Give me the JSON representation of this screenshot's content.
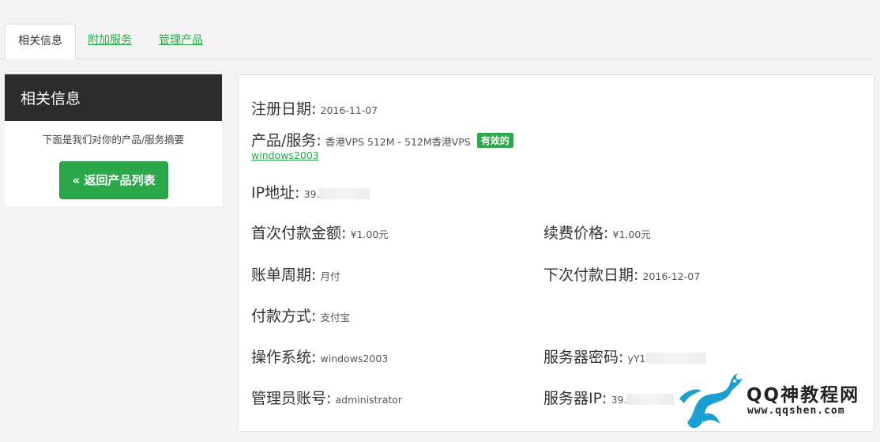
{
  "tabs": [
    {
      "label": "相关信息",
      "active": true
    },
    {
      "label": "附加服务",
      "active": false
    },
    {
      "label": "管理产品",
      "active": false
    }
  ],
  "sidebar": {
    "title": "相关信息",
    "description": "下面是我们对你的产品/服务摘要",
    "back_button": "« 返回产品列表"
  },
  "details": {
    "reg_date": {
      "label": "注册日期:",
      "value": "2016-11-07"
    },
    "product": {
      "label": "产品/服务:",
      "value": "香港VPS 512M - 512M香港VPS",
      "status": "有效的",
      "hostname": "windows2003"
    },
    "ip": {
      "label": "IP地址:",
      "value": "39."
    },
    "first_payment": {
      "label": "首次付款金额:",
      "value": "¥1.00元"
    },
    "renew_price": {
      "label": "续费价格:",
      "value": "¥1.00元"
    },
    "billing_cycle": {
      "label": "账单周期:",
      "value": "月付"
    },
    "next_due": {
      "label": "下次付款日期:",
      "value": "2016-12-07"
    },
    "payment_method": {
      "label": "付款方式:",
      "value": "支付宝"
    },
    "os": {
      "label": "操作系统:",
      "value": "windows2003"
    },
    "server_password": {
      "label": "服务器密码:",
      "value": "yY1"
    },
    "admin_account": {
      "label": "管理员账号:",
      "value": "administrator"
    },
    "server_ip": {
      "label": "服务器IP:",
      "value": "39."
    }
  },
  "watermark": {
    "title": "QQ神教程网",
    "url": "www.qqshen.com",
    "icon": "dragon-logo"
  },
  "colors": {
    "accent": "#2ba84a",
    "sidebar_header": "#2c2c2c",
    "background": "#f3f3f3"
  }
}
